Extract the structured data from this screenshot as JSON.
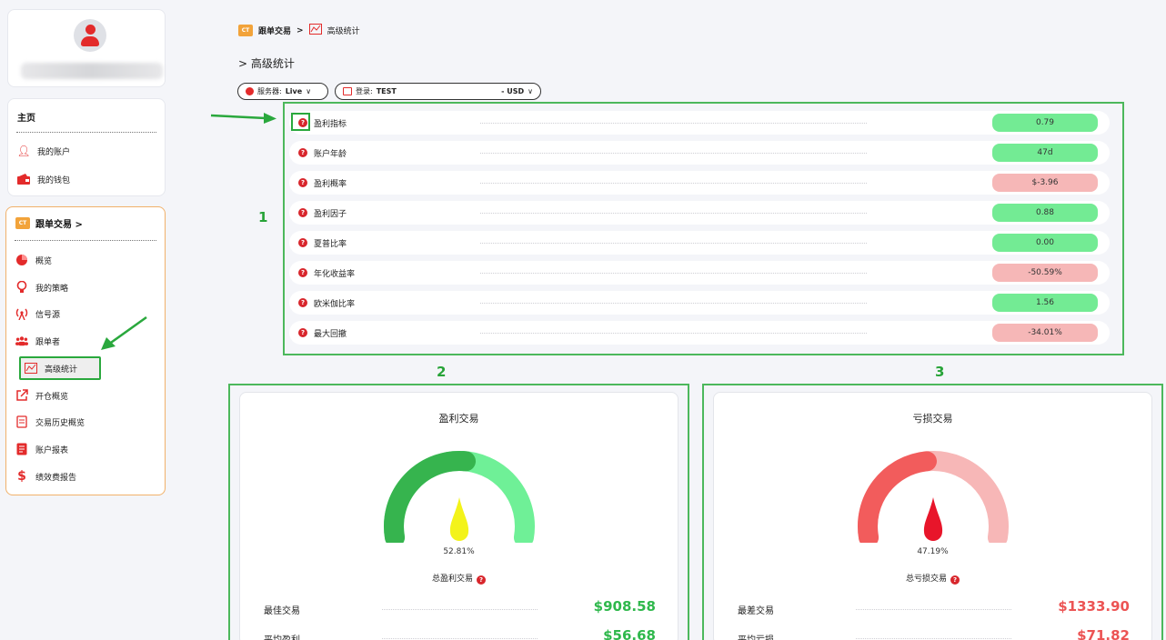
{
  "breadcrumb": {
    "root": "跟单交易",
    "separator": ">",
    "current": "高级统计",
    "logo_text": "CT"
  },
  "page_title": "> 高级统计",
  "filters": {
    "server_label": "服务器:",
    "server_value": "Live",
    "login_label": "登录:",
    "login_value": "TEST",
    "currency": "- USD"
  },
  "sidebar": {
    "home": {
      "title": "主页",
      "items": [
        {
          "label": "我的账户",
          "icon": "user-icon"
        },
        {
          "label": "我的钱包",
          "icon": "wallet-icon"
        }
      ]
    },
    "copy_trading": {
      "title": "跟单交易 >",
      "items": [
        {
          "label": "概览",
          "icon": "pie-chart-icon"
        },
        {
          "label": "我的策略",
          "icon": "lightbulb-icon"
        },
        {
          "label": "信号源",
          "icon": "signal-icon"
        },
        {
          "label": "跟单者",
          "icon": "users-icon"
        },
        {
          "label": "高级统计",
          "icon": "stats-icon"
        },
        {
          "label": "开仓概览",
          "icon": "external-link-icon"
        },
        {
          "label": "交易历史概览",
          "icon": "history-icon"
        },
        {
          "label": "账户报表",
          "icon": "report-icon"
        },
        {
          "label": "绩效费报告",
          "icon": "dollar-icon"
        }
      ]
    }
  },
  "metrics": [
    {
      "label": "盈利指标",
      "value": "0.79",
      "status": "positive"
    },
    {
      "label": "账户年龄",
      "value": "47d",
      "status": "positive"
    },
    {
      "label": "盈利概率",
      "value": "$-3.96",
      "status": "negative"
    },
    {
      "label": "盈利因子",
      "value": "0.88",
      "status": "positive"
    },
    {
      "label": "夏普比率",
      "value": "0.00",
      "status": "positive"
    },
    {
      "label": "年化收益率",
      "value": "-50.59%",
      "status": "negative"
    },
    {
      "label": "欧米伽比率",
      "value": "1.56",
      "status": "positive"
    },
    {
      "label": "最大回撤",
      "value": "-34.01%",
      "status": "negative"
    }
  ],
  "annotations": [
    "1",
    "2",
    "3"
  ],
  "profit_card": {
    "title": "盈利交易",
    "percent": "52.81%",
    "percent_value": 52.81,
    "subtitle": "总盈利交易",
    "stats": [
      {
        "label": "最佳交易",
        "value": "$908.58"
      },
      {
        "label": "平均盈利",
        "value": "$56.68"
      }
    ]
  },
  "loss_card": {
    "title": "亏损交易",
    "percent": "47.19%",
    "percent_value": 47.19,
    "subtitle": "总亏损交易",
    "stats": [
      {
        "label": "最差交易",
        "value": "$1333.90"
      },
      {
        "label": "平均亏损",
        "value": "$71.82"
      }
    ]
  },
  "colors": {
    "accent_red": "#e32b2b",
    "positive_bg": "#73eb94",
    "negative_bg": "#f6b7b7",
    "highlight_green": "#2aa83d",
    "profit_dark": "#36b44e",
    "profit_light": "#6ff097",
    "loss_dark": "#f25c5c",
    "loss_light": "#f7b7b7",
    "profit_needle": "#f3f31a",
    "loss_needle": "#e8152a"
  }
}
